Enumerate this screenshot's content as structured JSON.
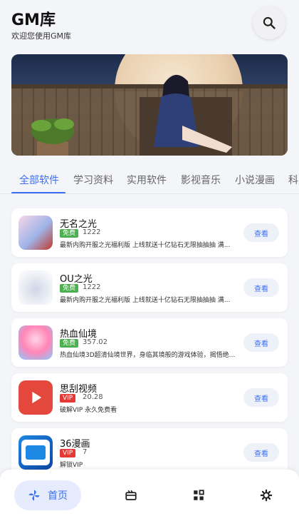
{
  "header": {
    "title": "GM库",
    "subtitle": "欢迎您使用GM库",
    "search_icon": "search-icon"
  },
  "banner": {
    "description_icon": "banner-image"
  },
  "tabs": [
    {
      "label": "全部软件",
      "active": true
    },
    {
      "label": "学习资料",
      "active": false
    },
    {
      "label": "实用软件",
      "active": false
    },
    {
      "label": "影视音乐",
      "active": false
    },
    {
      "label": "小说漫画",
      "active": false
    },
    {
      "label": "科",
      "active": false
    }
  ],
  "apps": [
    {
      "name": "无名之光",
      "badge": "免费",
      "badge_type": "free",
      "count": "1222",
      "desc": "最新内购开服之光福利版 上线就送十亿钻石无限抽抽抽 满...",
      "button": "查看"
    },
    {
      "name": "OU之光",
      "badge": "免费",
      "badge_type": "free",
      "count": "1222",
      "desc": "最新内购开服之光福利版 上线就送十亿钻石无限抽抽抽 满...",
      "button": "查看"
    },
    {
      "name": "热血仙境",
      "badge": "免费",
      "badge_type": "free",
      "count": "357.02",
      "desc": "热血仙境3D超清仙境世界，身临其境般的游戏体验，揭悟绝...",
      "button": "查看"
    },
    {
      "name": "思刮视频",
      "badge": "VIP",
      "badge_type": "vip",
      "count": "20.28",
      "desc": "破解VIP 永久免费看",
      "button": "查看"
    },
    {
      "name": "36漫画",
      "badge": "VIP",
      "badge_type": "vip",
      "count": "7",
      "desc": "解锁VIP",
      "button": "查看"
    }
  ],
  "nav": {
    "home_label": "首页",
    "colors": {
      "accent": "#3b6ff5",
      "free": "#4caf50",
      "vip": "#e53935"
    }
  }
}
